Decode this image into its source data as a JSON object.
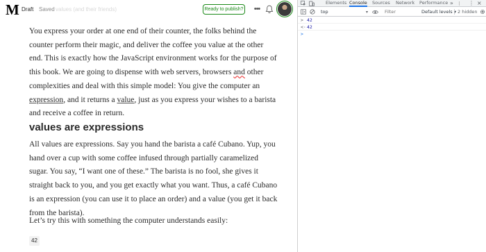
{
  "editor": {
    "logo": "M",
    "status_draft": "Draft",
    "status_saved": "Saved",
    "faded_title": "values (and their friends)",
    "publish_label": "Ready to publish?",
    "more_label": "•••",
    "paragraph1": [
      "You express your order at one end of their counter, the folks behind the",
      "counter perform their magic, and deliver the coffee you value at the other",
      "end. This is exactly how the JavaScript environment works for the purpose of",
      "this book. We are going to dispense with web servers, browsers and other",
      "complexities and deal with this simple model: You give the computer an",
      "expression, and it returns a value, just as you express your wishes to a barista",
      "and receive a coffee in return."
    ],
    "p1_line4_a": "this book. We are going to dispense with web servers, browsers ",
    "p1_line4_b": "and",
    "p1_line4_c": " other",
    "p1_line6_a": "expression",
    "p1_line6_b": ", and it returns a ",
    "p1_line6_c": "value",
    "p1_line6_d": ", just as you express your wishes to a barista",
    "heading": "values are expressions",
    "paragraph2": [
      "All values are expressions. Say you hand the barista a café Cubano. Yup, you",
      "hand over a cup with some coffee infused through partially caramelized",
      "sugar. You say, “I want one of these.” The barista is no fool, she gives it",
      "straight back to you, and you get exactly what you want. Thus, a café Cubano",
      "is an expression (you can use it to place an order) and a value (you get it back",
      "from the barista)."
    ],
    "paragraph3": "Let’s try this with something the computer understands easily:",
    "code": "42"
  },
  "devtools": {
    "tabs": [
      {
        "label": "Elements",
        "active": false
      },
      {
        "label": "Console",
        "active": true
      },
      {
        "label": "Sources",
        "active": false
      },
      {
        "label": "Network",
        "active": false
      },
      {
        "label": "Performance",
        "active": false
      }
    ],
    "more_tabs": "»",
    "kebab": "⋮",
    "close": "×",
    "context": "top",
    "filter_placeholder": "Filter",
    "levels": "Default levels ▾",
    "hidden": "2 hidden",
    "console_lines": [
      {
        "chevron": ">",
        "value": "42"
      },
      {
        "chevron": "<·",
        "value": "42"
      },
      {
        "chevron": ">",
        "value": ""
      }
    ]
  },
  "colors": {
    "brand_green": "#1a8917",
    "devtools_active_tab": "#1a73e8",
    "console_value": "#1a1aa6"
  }
}
